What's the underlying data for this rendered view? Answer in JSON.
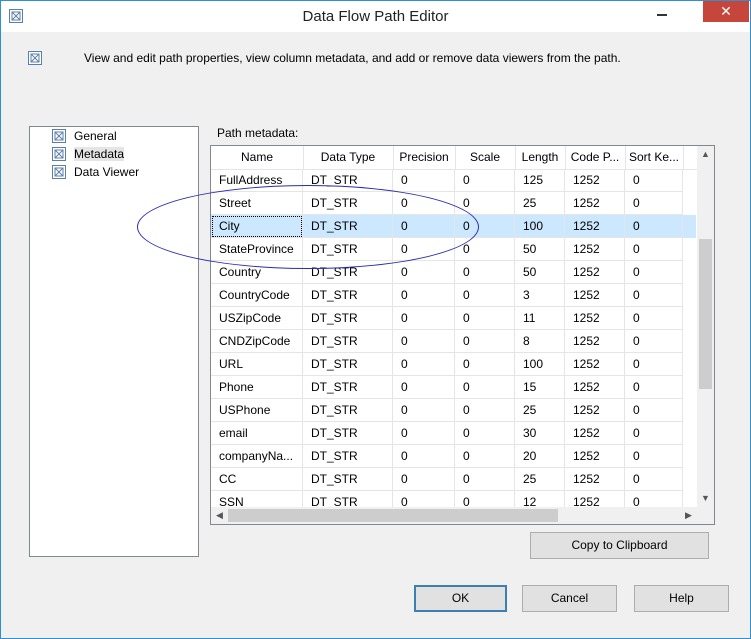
{
  "window": {
    "title": "Data Flow Path Editor",
    "close_glyph": "✕"
  },
  "header": {
    "description": "View and edit path properties, view column metadata, and add or remove data viewers from the path."
  },
  "nav": {
    "items": [
      {
        "label": "General",
        "icon": "property-page-icon"
      },
      {
        "label": "Metadata",
        "icon": "property-page-icon",
        "selected": true
      },
      {
        "label": "Data Viewer",
        "icon": "property-page-icon"
      }
    ]
  },
  "metadata": {
    "label": "Path metadata:",
    "columns": [
      "Name",
      "Data Type",
      "Precision",
      "Scale",
      "Length",
      "Code P...",
      "Sort Ke..."
    ],
    "selected_row": 2,
    "rows": [
      [
        "FullAddress",
        "DT_STR",
        "0",
        "0",
        "125",
        "1252",
        "0"
      ],
      [
        "Street",
        "DT_STR",
        "0",
        "0",
        "25",
        "1252",
        "0"
      ],
      [
        "City",
        "DT_STR",
        "0",
        "0",
        "100",
        "1252",
        "0"
      ],
      [
        "StateProvince",
        "DT_STR",
        "0",
        "0",
        "50",
        "1252",
        "0"
      ],
      [
        "Country",
        "DT_STR",
        "0",
        "0",
        "50",
        "1252",
        "0"
      ],
      [
        "CountryCode",
        "DT_STR",
        "0",
        "0",
        "3",
        "1252",
        "0"
      ],
      [
        "USZipCode",
        "DT_STR",
        "0",
        "0",
        "11",
        "1252",
        "0"
      ],
      [
        "CNDZipCode",
        "DT_STR",
        "0",
        "0",
        "8",
        "1252",
        "0"
      ],
      [
        "URL",
        "DT_STR",
        "0",
        "0",
        "100",
        "1252",
        "0"
      ],
      [
        "Phone",
        "DT_STR",
        "0",
        "0",
        "15",
        "1252",
        "0"
      ],
      [
        "USPhone",
        "DT_STR",
        "0",
        "0",
        "25",
        "1252",
        "0"
      ],
      [
        "email",
        "DT_STR",
        "0",
        "0",
        "30",
        "1252",
        "0"
      ],
      [
        "companyNa...",
        "DT_STR",
        "0",
        "0",
        "20",
        "1252",
        "0"
      ],
      [
        "CC",
        "DT_STR",
        "0",
        "0",
        "25",
        "1252",
        "0"
      ],
      [
        "SSN",
        "DT_STR",
        "0",
        "0",
        "12",
        "1252",
        "0"
      ]
    ]
  },
  "buttons": {
    "copy": "Copy to Clipboard",
    "ok": "OK",
    "cancel": "Cancel",
    "help": "Help"
  },
  "colors": {
    "selection": "#cce8ff",
    "annotation_ellipse": "#2b2bb0",
    "close_button": "#c7463b"
  }
}
